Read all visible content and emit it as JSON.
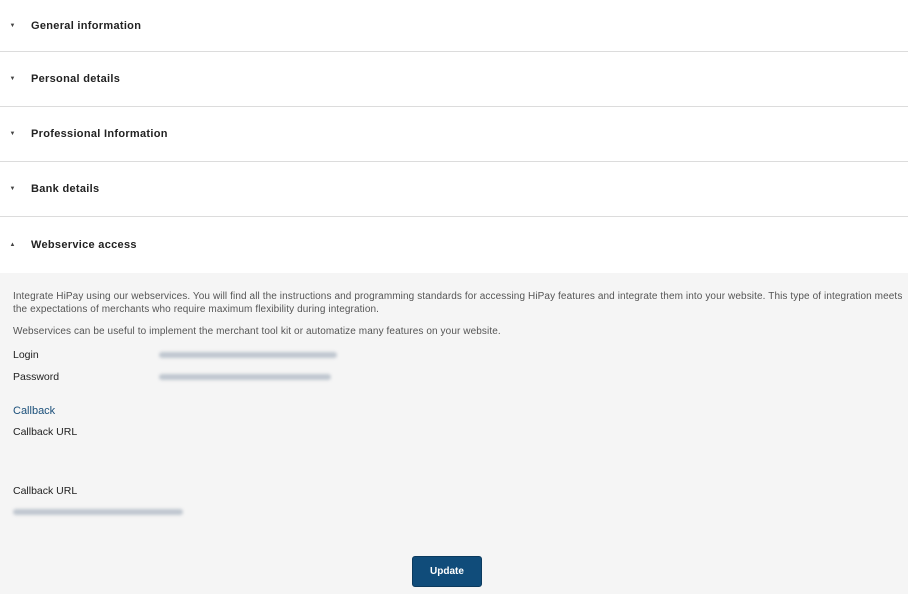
{
  "sections": [
    {
      "title": "General information",
      "arrow": "▼"
    },
    {
      "title": "Personal details",
      "arrow": "▼"
    },
    {
      "title": "Professional Information",
      "arrow": "▼"
    },
    {
      "title": "Bank details",
      "arrow": "▼"
    },
    {
      "title": "Webservice access",
      "arrow": "▲"
    }
  ],
  "webservice": {
    "intro_1": "Integrate HiPay using our webservices. You will find all the instructions and programming standards for accessing HiPay features and integrate them into your website. This type of integration meets the expectations of merchants who require maximum flexibility during integration.",
    "intro_2": "Webservices can be useful to implement the merchant tool kit or automatize many features on your website.",
    "login_label": "Login",
    "password_label": "Password",
    "callback_heading": "Callback",
    "callback_url_label": "Callback URL",
    "callback_url_label_2": "Callback URL",
    "update_label": "Update"
  }
}
